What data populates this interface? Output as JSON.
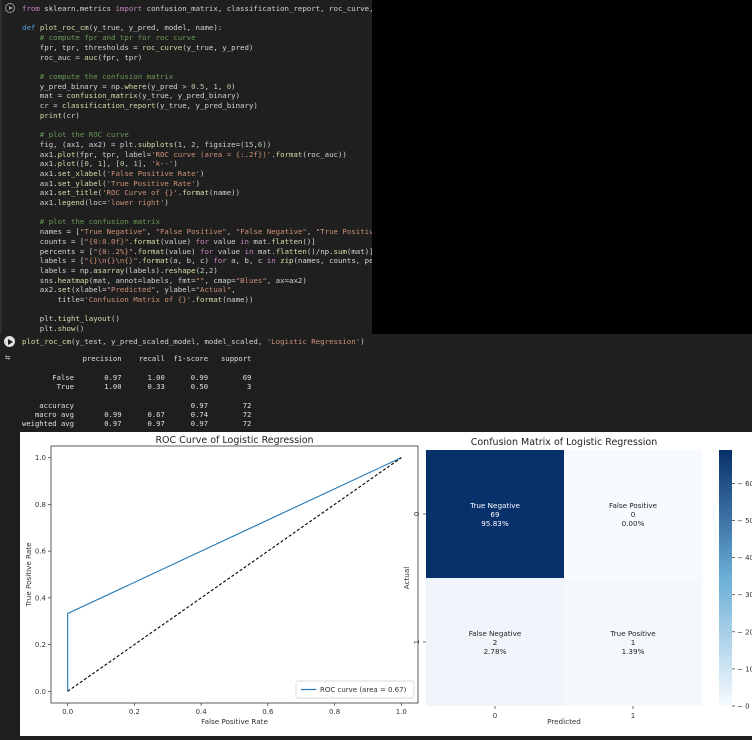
{
  "code_lines": [
    [
      [
        "kw",
        "from"
      ],
      [
        "plain",
        " sklearn.metrics "
      ],
      [
        "kw",
        "import"
      ],
      [
        "plain",
        " confusion_matrix, classification_report, roc_curve, auc"
      ]
    ],
    [],
    [
      [
        "def",
        "def"
      ],
      [
        "plain",
        " "
      ],
      [
        "fn",
        "plot_roc_cm"
      ],
      [
        "plain",
        "(y_true, y_pred, model, name):"
      ]
    ],
    [
      [
        "com",
        "    # compute fpr and tpr for roc curve"
      ]
    ],
    [
      [
        "plain",
        "    fpr, tpr, thresholds = "
      ],
      [
        "fn",
        "roc_curve"
      ],
      [
        "plain",
        "(y_true, y_pred)"
      ]
    ],
    [
      [
        "plain",
        "    roc_auc = "
      ],
      [
        "fn",
        "auc"
      ],
      [
        "plain",
        "(fpr, tpr)"
      ]
    ],
    [],
    [
      [
        "com",
        "    # compute the confusion matrix"
      ]
    ],
    [
      [
        "plain",
        "    y_pred_binary = np."
      ],
      [
        "fn",
        "where"
      ],
      [
        "plain",
        "(y_pred > "
      ],
      [
        "num",
        "0.5"
      ],
      [
        "plain",
        ", "
      ],
      [
        "num",
        "1"
      ],
      [
        "plain",
        ", "
      ],
      [
        "num",
        "0"
      ],
      [
        "plain",
        ")"
      ]
    ],
    [
      [
        "plain",
        "    mat = "
      ],
      [
        "fn",
        "confusion_matrix"
      ],
      [
        "plain",
        "(y_true, y_pred_binary)"
      ]
    ],
    [
      [
        "plain",
        "    cr = "
      ],
      [
        "fn",
        "classification_report"
      ],
      [
        "plain",
        "(y_true, y_pred_binary)"
      ]
    ],
    [
      [
        "plain",
        "    "
      ],
      [
        "fn",
        "print"
      ],
      [
        "plain",
        "(cr)"
      ]
    ],
    [],
    [
      [
        "com",
        "    # plot the ROC curve"
      ]
    ],
    [
      [
        "plain",
        "    fig, (ax1, ax2) = plt."
      ],
      [
        "fn",
        "subplots"
      ],
      [
        "plain",
        "("
      ],
      [
        "num",
        "1"
      ],
      [
        "plain",
        ", "
      ],
      [
        "num",
        "2"
      ],
      [
        "plain",
        ", figsize=("
      ],
      [
        "num",
        "15"
      ],
      [
        "plain",
        ","
      ],
      [
        "num",
        "6"
      ],
      [
        "plain",
        "))"
      ]
    ],
    [
      [
        "plain",
        "    ax1."
      ],
      [
        "fn",
        "plot"
      ],
      [
        "plain",
        "(fpr, tpr, label="
      ],
      [
        "str",
        "'ROC curve (area = {:.2f})'"
      ],
      [
        "plain",
        "."
      ],
      [
        "fn",
        "format"
      ],
      [
        "plain",
        "(roc_auc))"
      ]
    ],
    [
      [
        "plain",
        "    ax1."
      ],
      [
        "fn",
        "plot"
      ],
      [
        "plain",
        "(["
      ],
      [
        "num",
        "0"
      ],
      [
        "plain",
        ", "
      ],
      [
        "num",
        "1"
      ],
      [
        "plain",
        "], ["
      ],
      [
        "num",
        "0"
      ],
      [
        "plain",
        ", "
      ],
      [
        "num",
        "1"
      ],
      [
        "plain",
        "], "
      ],
      [
        "str",
        "'k--'"
      ],
      [
        "plain",
        ")"
      ]
    ],
    [
      [
        "plain",
        "    ax1."
      ],
      [
        "fn",
        "set_xlabel"
      ],
      [
        "plain",
        "("
      ],
      [
        "str",
        "'False Positive Rate'"
      ],
      [
        "plain",
        ")"
      ]
    ],
    [
      [
        "plain",
        "    ax1."
      ],
      [
        "fn",
        "set_ylabel"
      ],
      [
        "plain",
        "("
      ],
      [
        "str",
        "'True Positive Rate'"
      ],
      [
        "plain",
        ")"
      ]
    ],
    [
      [
        "plain",
        "    ax1."
      ],
      [
        "fn",
        "set_title"
      ],
      [
        "plain",
        "("
      ],
      [
        "str",
        "'ROC Curve of {}'"
      ],
      [
        "plain",
        "."
      ],
      [
        "fn",
        "format"
      ],
      [
        "plain",
        "(name))"
      ]
    ],
    [
      [
        "plain",
        "    ax1."
      ],
      [
        "fn",
        "legend"
      ],
      [
        "plain",
        "(loc="
      ],
      [
        "str",
        "'lower right'"
      ],
      [
        "plain",
        ")"
      ]
    ],
    [],
    [
      [
        "com",
        "    # plot the confusion matrix"
      ]
    ],
    [
      [
        "plain",
        "    names = ["
      ],
      [
        "str",
        "\"True Negative\""
      ],
      [
        "plain",
        ", "
      ],
      [
        "str",
        "\"False Positive\""
      ],
      [
        "plain",
        ", "
      ],
      [
        "str",
        "\"False Negative\""
      ],
      [
        "plain",
        ", "
      ],
      [
        "str",
        "\"True Positive\""
      ],
      [
        "plain",
        "]"
      ]
    ],
    [
      [
        "plain",
        "    counts = ["
      ],
      [
        "str",
        "\"{0:0.0f}\""
      ],
      [
        "plain",
        "."
      ],
      [
        "fn",
        "format"
      ],
      [
        "plain",
        "(value) "
      ],
      [
        "kw",
        "for"
      ],
      [
        "plain",
        " value "
      ],
      [
        "kw",
        "in"
      ],
      [
        "plain",
        " mat."
      ],
      [
        "fn",
        "flatten"
      ],
      [
        "plain",
        "()]"
      ]
    ],
    [
      [
        "plain",
        "    percents = ["
      ],
      [
        "str",
        "\"{0:.2%}\""
      ],
      [
        "plain",
        "."
      ],
      [
        "fn",
        "format"
      ],
      [
        "plain",
        "(value) "
      ],
      [
        "kw",
        "for"
      ],
      [
        "plain",
        " value "
      ],
      [
        "kw",
        "in"
      ],
      [
        "plain",
        " mat."
      ],
      [
        "fn",
        "flatten"
      ],
      [
        "plain",
        "()/np."
      ],
      [
        "fn",
        "sum"
      ],
      [
        "plain",
        "(mat)]"
      ]
    ],
    [
      [
        "plain",
        "    labels = ["
      ],
      [
        "str",
        "\"{}\\n{}\\n{}\""
      ],
      [
        "plain",
        "."
      ],
      [
        "fn",
        "format"
      ],
      [
        "plain",
        "(a, b, c) "
      ],
      [
        "kw",
        "for"
      ],
      [
        "plain",
        " a, b, c "
      ],
      [
        "kw",
        "in"
      ],
      [
        "plain",
        " "
      ],
      [
        "fn",
        "zip"
      ],
      [
        "plain",
        "(names, counts, percents)]"
      ]
    ],
    [
      [
        "plain",
        "    labels = np."
      ],
      [
        "fn",
        "asarray"
      ],
      [
        "plain",
        "(labels)."
      ],
      [
        "fn",
        "reshape"
      ],
      [
        "plain",
        "("
      ],
      [
        "num",
        "2"
      ],
      [
        "plain",
        ","
      ],
      [
        "num",
        "2"
      ],
      [
        "plain",
        ")"
      ]
    ],
    [
      [
        "plain",
        "    sns."
      ],
      [
        "fn",
        "heatmap"
      ],
      [
        "plain",
        "(mat, annot=labels, fmt="
      ],
      [
        "str",
        "\"\""
      ],
      [
        "plain",
        ", cmap="
      ],
      [
        "str",
        "\"Blues\""
      ],
      [
        "plain",
        ", ax=ax2)"
      ]
    ],
    [
      [
        "plain",
        "    ax2."
      ],
      [
        "fn",
        "set"
      ],
      [
        "plain",
        "(xlabel="
      ],
      [
        "str",
        "\"Predicted\""
      ],
      [
        "plain",
        ", ylabel="
      ],
      [
        "str",
        "\"Actual\""
      ],
      [
        "plain",
        ","
      ]
    ],
    [
      [
        "plain",
        "        title="
      ],
      [
        "str",
        "'Confusion Matrix of {}'"
      ],
      [
        "plain",
        "."
      ],
      [
        "fn",
        "format"
      ],
      [
        "plain",
        "(name))"
      ]
    ],
    [],
    [
      [
        "plain",
        "    plt."
      ],
      [
        "fn",
        "tight_layout"
      ],
      [
        "plain",
        "()"
      ]
    ],
    [
      [
        "plain",
        "    plt."
      ],
      [
        "fn",
        "show"
      ],
      [
        "plain",
        "()"
      ]
    ]
  ],
  "cell2_line": [
    [
      "fn",
      "plot_roc_cm"
    ],
    [
      "plain",
      "(y_test, y_pred_scaled_model, model_scaled, "
    ],
    [
      "str",
      "'Logistic Regression'"
    ],
    [
      "plain",
      ")"
    ]
  ],
  "output_icon": "⇆",
  "report_lines": [
    "              precision    recall  f1-score   support",
    "",
    "       False       0.97      1.00      0.99        69",
    "        True       1.00      0.33      0.50         3",
    "",
    "    accuracy                           0.97        72",
    "   macro avg       0.99      0.67      0.74        72",
    "weighted avg       0.97      0.97      0.97        72"
  ],
  "colors": {
    "roc_line": "#1f77b4",
    "diag_line": "#000000",
    "cm_dark": "#08306b",
    "cm_light": "#f7fbff"
  },
  "chart_data": [
    {
      "type": "line",
      "title": "ROC Curve of Logistic Regression",
      "xlabel": "False Positive Rate",
      "ylabel": "True Positive Rate",
      "xlim": [
        -0.05,
        1.05
      ],
      "ylim": [
        -0.05,
        1.05
      ],
      "x_ticks": [
        "0.0",
        "0.2",
        "0.4",
        "0.6",
        "0.8",
        "1.0"
      ],
      "y_ticks": [
        "0.0",
        "0.2",
        "0.4",
        "0.6",
        "0.8",
        "1.0"
      ],
      "series": [
        {
          "name": "ROC curve (area = 0.67)",
          "x": [
            0,
            0,
            1
          ],
          "y": [
            0,
            0.333,
            1
          ],
          "style": "solid"
        },
        {
          "x": [
            0,
            1
          ],
          "y": [
            0,
            1
          ],
          "style": "dashed"
        }
      ],
      "legend_position": "lower right"
    },
    {
      "type": "heatmap",
      "title": "Confusion Matrix of Logistic Regression",
      "xlabel": "Predicted",
      "ylabel": "Actual",
      "x_ticks": [
        "0",
        "1"
      ],
      "y_ticks": [
        "0",
        "1"
      ],
      "cells": [
        {
          "row": 0,
          "col": 0,
          "value": 69,
          "lines": [
            "True Negative",
            "69",
            "95.83%"
          ]
        },
        {
          "row": 0,
          "col": 1,
          "value": 0,
          "lines": [
            "False Positive",
            "0",
            "0.00%"
          ]
        },
        {
          "row": 1,
          "col": 0,
          "value": 2,
          "lines": [
            "False Negative",
            "2",
            "2.78%"
          ]
        },
        {
          "row": 1,
          "col": 1,
          "value": 1,
          "lines": [
            "True Positive",
            "1",
            "1.39%"
          ]
        }
      ],
      "colorbar_ticks": [
        "0",
        "10",
        "20",
        "30",
        "40",
        "50",
        "60"
      ],
      "colorbar_range": [
        0,
        69
      ]
    }
  ]
}
